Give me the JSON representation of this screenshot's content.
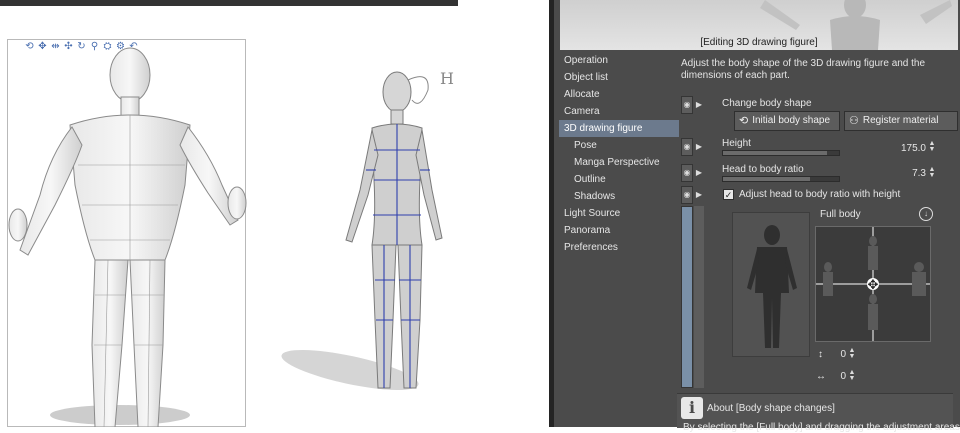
{
  "canvas": {
    "annotation": "H",
    "toolbar_icons": [
      "move-camera-icon",
      "rotate-camera-icon",
      "pan-camera-icon",
      "move-object-icon",
      "rotate-object-icon",
      "lock-icon",
      "scale-icon",
      "reset-icon",
      "undo-icon"
    ]
  },
  "panel": {
    "preview_caption": "[Editing 3D drawing figure]",
    "nav": [
      {
        "label": "Operation",
        "sub": false
      },
      {
        "label": "Object list",
        "sub": false
      },
      {
        "label": "Allocate",
        "sub": false
      },
      {
        "label": "Camera",
        "sub": false
      },
      {
        "label": "3D drawing figure",
        "sub": false,
        "active": true
      },
      {
        "label": "Pose",
        "sub": true
      },
      {
        "label": "Manga Perspective",
        "sub": true
      },
      {
        "label": "Outline",
        "sub": true
      },
      {
        "label": "Shadows",
        "sub": true
      },
      {
        "label": "Light Source",
        "sub": false
      },
      {
        "label": "Panorama",
        "sub": false
      },
      {
        "label": "Preferences",
        "sub": false
      }
    ],
    "description": "Adjust the body shape of the 3D drawing figure and the dimensions of each part.",
    "change_body_shape": "Change body shape",
    "initial_body_shape": "Initial body shape",
    "register_material": "Register material",
    "height_label": "Height",
    "height_value": "175.0",
    "height_fill": 0.9,
    "head_ratio_label": "Head to body ratio",
    "head_ratio_value": "7.3",
    "head_ratio_fill": 0.75,
    "adjust_checkbox": "Adjust head to body ratio with height",
    "full_body": "Full body",
    "vertical_value": "0",
    "horizontal_value": "0",
    "about_title": "About [Body shape changes]",
    "about_text": "By selecting the [Full body] and dragging the adjustment areas"
  },
  "colors": {
    "panel_bg": "#4b4b4b",
    "nav_active": "#6c7a8d",
    "wireframe": "#2f3fae"
  }
}
